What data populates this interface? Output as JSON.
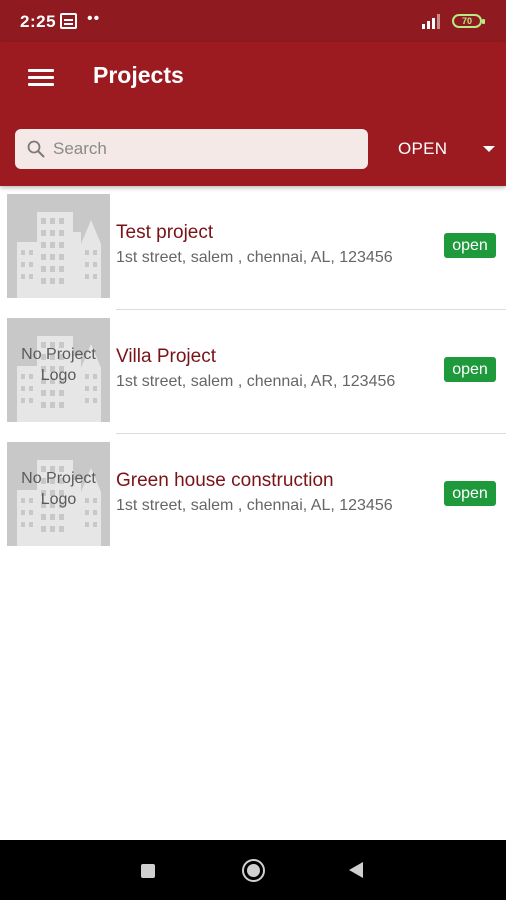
{
  "status_bar": {
    "time": "2:25",
    "dots": "••",
    "battery": "70"
  },
  "header": {
    "title": "Projects"
  },
  "search": {
    "placeholder": "Search",
    "value": ""
  },
  "filter": {
    "selected": "OPEN"
  },
  "projects": [
    {
      "name": "Test project",
      "address": "1st street, salem , chennai, AL, 123456",
      "status": "open",
      "logo_text": ""
    },
    {
      "name": "Villa Project",
      "address": "1st street, salem , chennai, AR, 123456",
      "status": "open",
      "logo_text": "No Project Logo"
    },
    {
      "name": "Green house construction",
      "address": "1st street, salem , chennai, AL, 123456",
      "status": "open",
      "logo_text": "No Project Logo"
    }
  ],
  "colors": {
    "app_bar": "#9c1b21",
    "status_bar": "#8f1a1f",
    "project_name": "#7a1317",
    "status_open": "#1e9a3c"
  }
}
